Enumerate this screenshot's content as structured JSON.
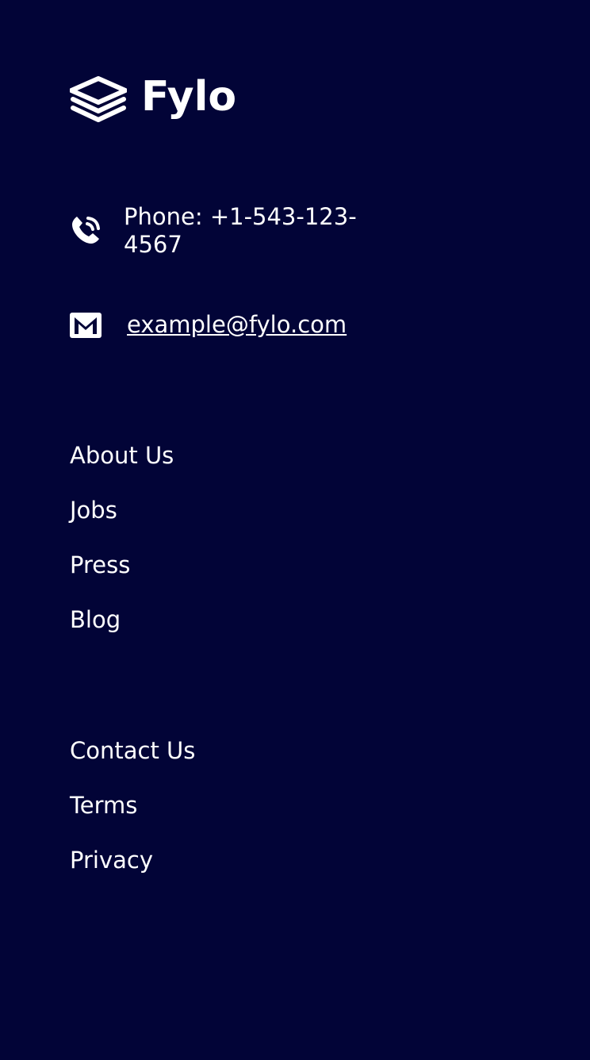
{
  "brand": {
    "name": "Fylo",
    "icon": "stacked-layers-icon"
  },
  "contact": {
    "phone": {
      "icon": "phone-icon",
      "text": "Phone: +1-543-123-4567"
    },
    "email": {
      "icon": "mail-icon",
      "text": "example@fylo.com"
    }
  },
  "links": {
    "group_one": [
      "About Us",
      "Jobs",
      "Press",
      "Blog"
    ],
    "group_two": [
      "Contact Us",
      "Terms",
      "Privacy"
    ]
  },
  "colors": {
    "background": "#020437",
    "text": "#ffffff"
  }
}
